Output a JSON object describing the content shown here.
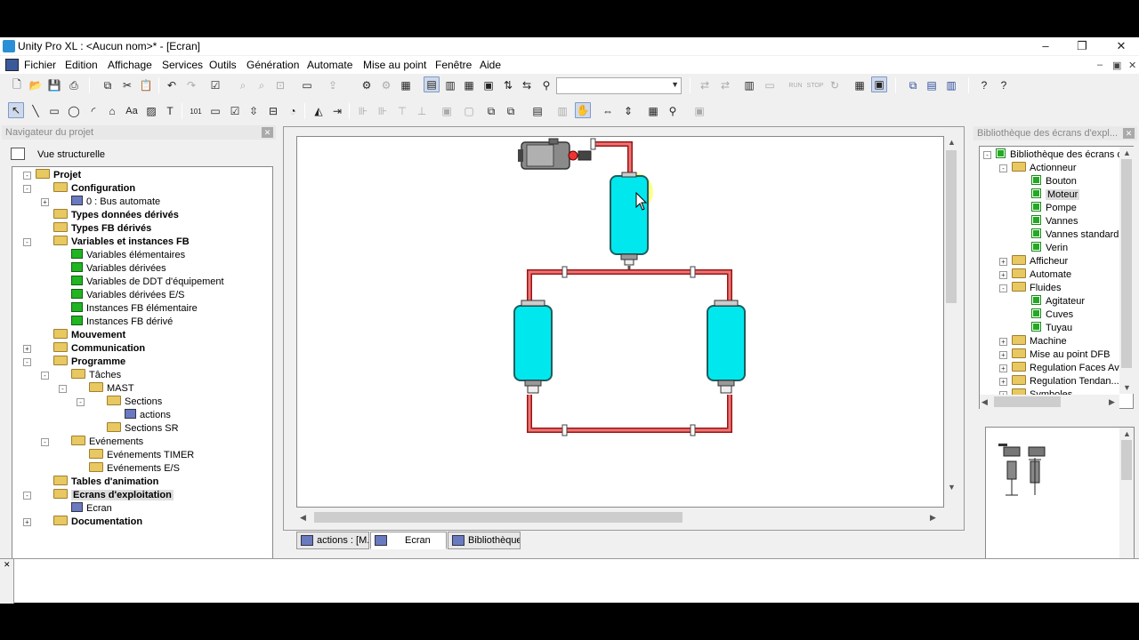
{
  "window": {
    "title": "Unity Pro XL : <Aucun nom>* - [Ecran]",
    "minimize": "–",
    "maximize": "❐",
    "close": "✕"
  },
  "menu": {
    "items": [
      "Fichier",
      "Edition",
      "Affichage",
      "Services",
      "Outils",
      "Génération",
      "Automate",
      "Mise au point",
      "Fenêtre",
      "Aide"
    ],
    "mdi": [
      "–",
      "▣",
      "✕"
    ]
  },
  "toolbar": {
    "combo_value": ""
  },
  "navigator": {
    "title": "Navigateur du projet",
    "view_label": "Vue structurelle",
    "nodes": [
      {
        "label": "Projet",
        "bold": true
      },
      {
        "label": "Configuration",
        "bold": true
      },
      {
        "label": "0 : Bus automate",
        "bold": false
      },
      {
        "label": "Types données dérivés",
        "bold": true
      },
      {
        "label": "Types FB dérivés",
        "bold": true
      },
      {
        "label": "Variables et instances FB",
        "bold": true
      },
      {
        "label": "Variables élémentaires",
        "bold": false
      },
      {
        "label": "Variables dérivées",
        "bold": false
      },
      {
        "label": "Variables de DDT d'équipement",
        "bold": false
      },
      {
        "label": "Variables dérivées E/S",
        "bold": false
      },
      {
        "label": "Instances FB élémentaire",
        "bold": false
      },
      {
        "label": "Instances FB dérivé",
        "bold": false
      },
      {
        "label": "Mouvement",
        "bold": true
      },
      {
        "label": "Communication",
        "bold": true
      },
      {
        "label": "Programme",
        "bold": true
      },
      {
        "label": "Tâches",
        "bold": false
      },
      {
        "label": "MAST",
        "bold": false
      },
      {
        "label": "Sections",
        "bold": false
      },
      {
        "label": "actions",
        "bold": false
      },
      {
        "label": "Sections SR",
        "bold": false
      },
      {
        "label": "Evénements",
        "bold": false
      },
      {
        "label": "Evénements TIMER",
        "bold": false
      },
      {
        "label": "Evénements E/S",
        "bold": false
      },
      {
        "label": "Tables d'animation",
        "bold": true
      },
      {
        "label": "Ecrans d'exploitation",
        "bold": true
      },
      {
        "label": "Ecran",
        "bold": false
      },
      {
        "label": "Documentation",
        "bold": true
      }
    ]
  },
  "library": {
    "title": "Bibliothèque des écrans d'expl...",
    "nodes": [
      {
        "label": "Bibliothèque des écrans d'e"
      },
      {
        "label": "Actionneur"
      },
      {
        "label": "Bouton"
      },
      {
        "label": "Moteur"
      },
      {
        "label": "Pompe"
      },
      {
        "label": "Vannes"
      },
      {
        "label": "Vannes standard"
      },
      {
        "label": "Verin"
      },
      {
        "label": "Afficheur"
      },
      {
        "label": "Automate"
      },
      {
        "label": "Fluides"
      },
      {
        "label": "Agitateur"
      },
      {
        "label": "Cuves"
      },
      {
        "label": "Tuyau"
      },
      {
        "label": "Machine"
      },
      {
        "label": "Mise au point DFB"
      },
      {
        "label": "Regulation Faces Av..."
      },
      {
        "label": "Regulation Tendan..."
      },
      {
        "label": "Symboles"
      }
    ]
  },
  "tabs": [
    {
      "label": "actions : [M..."
    },
    {
      "label": "Ecran"
    },
    {
      "label": "Bibliothèque..."
    }
  ],
  "colors": {
    "tank_fill": "#00e8ee",
    "tank_stroke": "#205c5c",
    "pipe_fill": "#e87878",
    "pipe_stroke": "#a01010",
    "highlight": "#ffff40"
  }
}
